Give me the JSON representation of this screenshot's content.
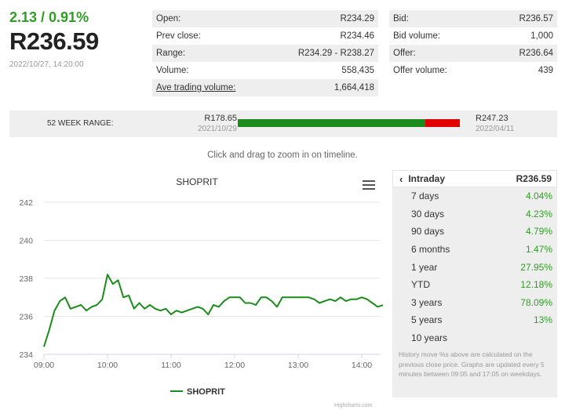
{
  "quote": {
    "change": "2.13 / 0.91%",
    "price": "R236.59",
    "timestamp": "2022/10/27, 14:20:00"
  },
  "stats_left": [
    {
      "label": "Open:",
      "value": "R234.29",
      "link": false
    },
    {
      "label": "Prev close:",
      "value": "R234.46",
      "link": false
    },
    {
      "label": "Range:",
      "value": "R234.29 - R238.27",
      "link": false
    },
    {
      "label": "Volume:",
      "value": "558,435",
      "link": false
    },
    {
      "label": "Ave trading volume:",
      "value": "1,664,418",
      "link": true
    }
  ],
  "stats_right": [
    {
      "label": "Bid:",
      "value": "R236.57"
    },
    {
      "label": "Bid volume:",
      "value": "1,000"
    },
    {
      "label": "Offer:",
      "value": "R236.64"
    },
    {
      "label": "Offer volume:",
      "value": "439"
    }
  ],
  "range52": {
    "title": "52 WEEK RANGE:",
    "low_value": "R178.65",
    "low_date": "2021/10/29",
    "high_value": "R247.23",
    "high_date": "2022/04/11",
    "current": 236.59,
    "low": 178.65,
    "high": 247.23,
    "color_gain": "#1b8c1b",
    "color_rest": "#e00000"
  },
  "hint": "Click and drag to zoom in on timeline.",
  "chart_data": {
    "type": "line",
    "title": "SHOPRIT",
    "ylim": [
      234,
      242
    ],
    "yticks": [
      234,
      236,
      238,
      240,
      242
    ],
    "xlim": [
      "09:00",
      "14:20"
    ],
    "xticks": [
      "09:00",
      "10:00",
      "11:00",
      "12:00",
      "13:00",
      "14:00"
    ],
    "grid": true,
    "legend": "bottom-center",
    "series": [
      {
        "name": "SHOPRIT",
        "color": "#1b8c1b",
        "x": [
          "09:00",
          "09:05",
          "09:10",
          "09:15",
          "09:20",
          "09:25",
          "09:30",
          "09:35",
          "09:40",
          "09:45",
          "09:50",
          "09:55",
          "10:00",
          "10:05",
          "10:10",
          "10:15",
          "10:20",
          "10:25",
          "10:30",
          "10:35",
          "10:40",
          "10:45",
          "10:50",
          "10:55",
          "11:00",
          "11:05",
          "11:10",
          "11:15",
          "11:20",
          "11:25",
          "11:30",
          "11:35",
          "11:40",
          "11:45",
          "11:50",
          "11:55",
          "12:00",
          "12:05",
          "12:10",
          "12:15",
          "12:20",
          "12:25",
          "12:30",
          "12:35",
          "12:40",
          "12:45",
          "12:50",
          "12:55",
          "13:00",
          "13:05",
          "13:10",
          "13:15",
          "13:20",
          "13:25",
          "13:30",
          "13:35",
          "13:40",
          "13:45",
          "13:50",
          "13:55",
          "14:00",
          "14:05",
          "14:10",
          "14:15",
          "14:20"
        ],
        "y": [
          234.4,
          235.3,
          236.3,
          236.8,
          237.0,
          236.4,
          236.5,
          236.6,
          236.3,
          236.5,
          236.6,
          236.9,
          238.2,
          237.7,
          237.9,
          237.0,
          237.1,
          236.4,
          236.7,
          236.4,
          236.6,
          236.4,
          236.3,
          236.4,
          236.1,
          236.3,
          236.2,
          236.3,
          236.4,
          236.5,
          236.4,
          236.1,
          236.6,
          236.5,
          236.8,
          237.0,
          237.0,
          237.0,
          236.7,
          236.7,
          236.6,
          237.0,
          237.0,
          236.8,
          236.5,
          237.0,
          237.0,
          237.0,
          237.0,
          237.0,
          237.0,
          236.9,
          236.7,
          236.8,
          236.9,
          236.8,
          237.0,
          236.8,
          236.9,
          236.9,
          237.0,
          236.9,
          236.7,
          236.5,
          236.59
        ]
      }
    ]
  },
  "chart_legend": "SHOPRIT",
  "chart_credit": "Highcharts.com",
  "performance": {
    "header_label": "Intraday",
    "header_value": "R236.59",
    "rows": [
      {
        "label": "7 days",
        "value": "4.04%"
      },
      {
        "label": "30 days",
        "value": "4.23%"
      },
      {
        "label": "90 days",
        "value": "4.79%"
      },
      {
        "label": "6 months",
        "value": "1.47%"
      },
      {
        "label": "1 year",
        "value": "27.95%"
      },
      {
        "label": "YTD",
        "value": "12.18%"
      },
      {
        "label": "3 years",
        "value": "78.09%"
      },
      {
        "label": "5 years",
        "value": "13%"
      },
      {
        "label": "10 years",
        "value": ""
      }
    ],
    "note": "History move %s above are calculated on the previous close price. Graphs are updated every 5 minutes between 09:05 and 17:05 on weekdays."
  },
  "icons": {
    "menu": "hamburger-menu-icon",
    "back": "chevron-left-icon"
  }
}
